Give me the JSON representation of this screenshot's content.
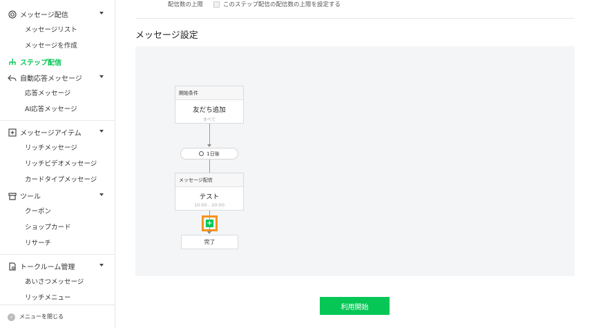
{
  "sidebar": {
    "sections": [
      {
        "label": "メッセージ配信",
        "icon": "target-icon"
      },
      {
        "label": "ステップ配信",
        "icon": "step-tree-icon",
        "active": true
      },
      {
        "label": "自動応答メッセージ",
        "icon": "reply-icon"
      },
      {
        "label": "メッセージアイテム",
        "icon": "add-box-icon"
      },
      {
        "label": "ツール",
        "icon": "shop-icon"
      },
      {
        "label": "トークルーム管理",
        "icon": "chat-settings-icon"
      }
    ],
    "items": {
      "message_list": "メッセージリスト",
      "create_message": "メッセージを作成",
      "reply_message": "応答メッセージ",
      "ai_reply": "AI応答メッセージ",
      "rich_message": "リッチメッセージ",
      "rich_video": "リッチビデオメッセージ",
      "card_type": "カードタイプメッセージ",
      "coupon": "クーポン",
      "shop_card": "ショップカード",
      "research": "リサーチ",
      "greeting": "あいさつメッセージ",
      "rich_menu": "リッチメニュー"
    },
    "close_menu": "メニューを閉じる",
    "close_icon_glyph": "«"
  },
  "main": {
    "limit_label": "配信数の上限",
    "limit_checkbox_label": "このステップ配信の配信数の上限を設定する",
    "section_title": "メッセージ設定",
    "flow": {
      "start_node": {
        "header": "開始条件",
        "title": "友だち追加",
        "sub": "すべて"
      },
      "delay_pill": "1日後",
      "message_node": {
        "header": "メッセージ配信",
        "title": "テスト",
        "sub": "10:00 - 20:00"
      },
      "add_glyph": "+",
      "end_label": "完了"
    },
    "start_button": "利用開始"
  },
  "colors": {
    "accent": "#06c755",
    "highlight": "#f7931e"
  }
}
